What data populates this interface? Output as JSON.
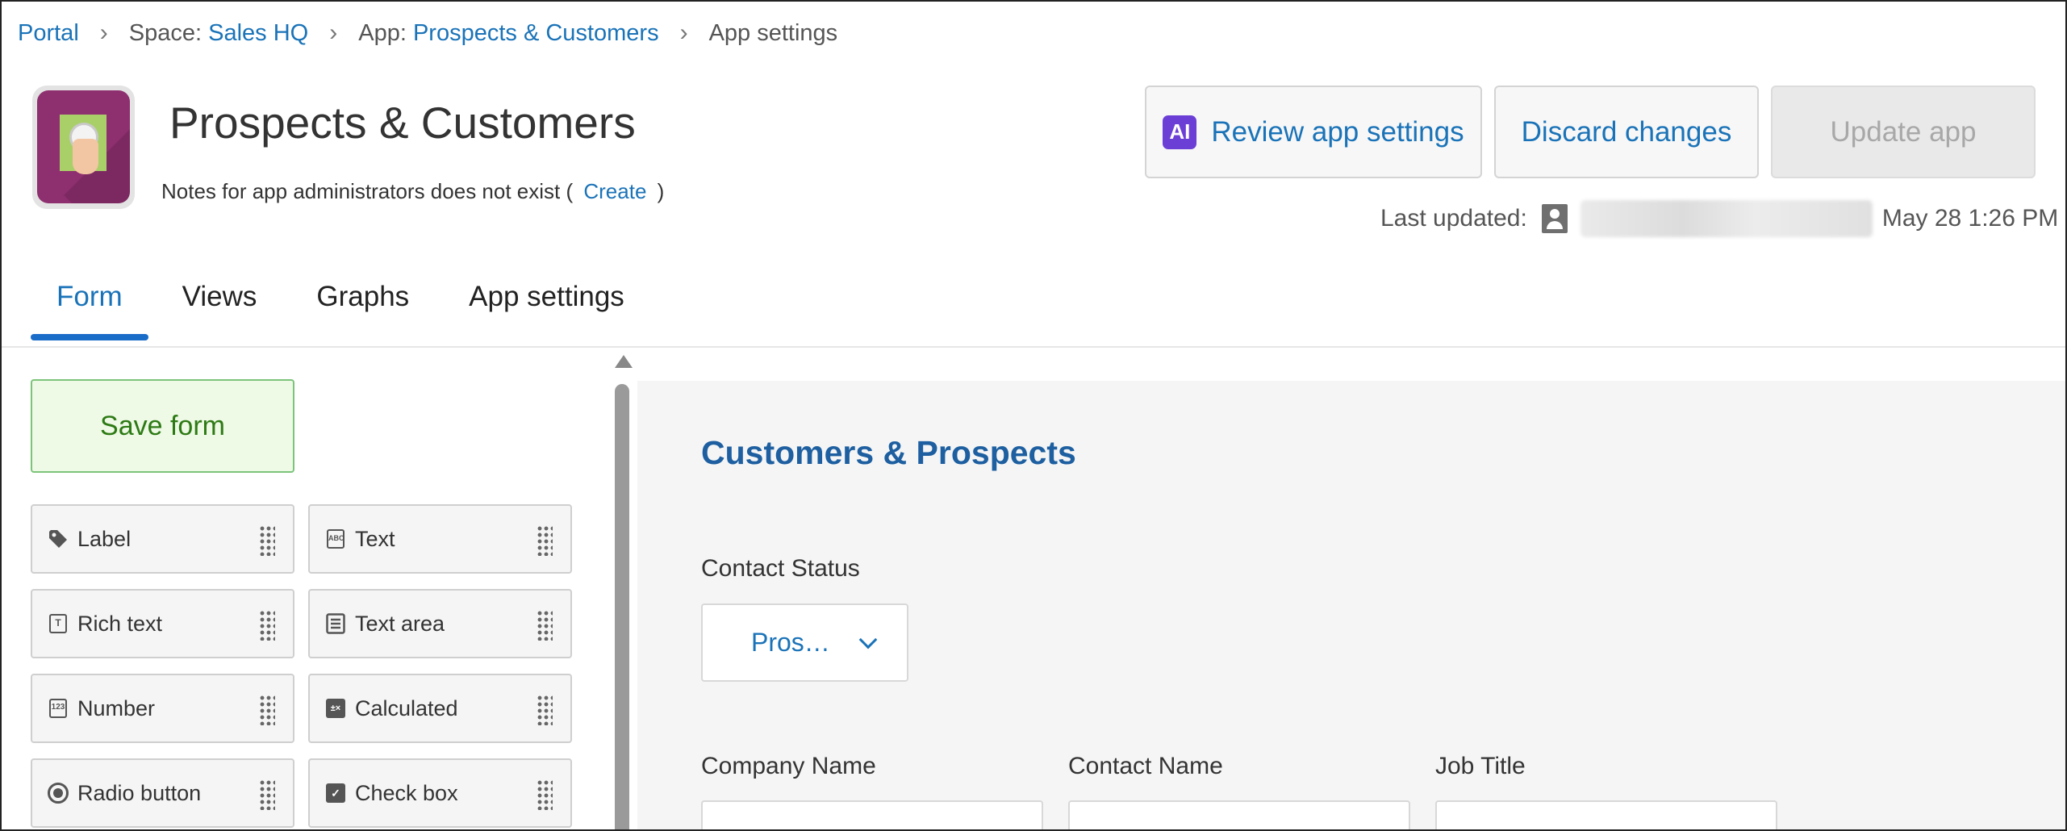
{
  "breadcrumb": {
    "portal": "Portal",
    "space_prefix": "Space:",
    "space_name": "Sales HQ",
    "app_prefix": "App:",
    "app_name": "Prospects & Customers",
    "current": "App settings"
  },
  "app": {
    "title": "Prospects & Customers",
    "notes_text": "Notes for app administrators does not exist (",
    "notes_link": "Create",
    "notes_close": ")"
  },
  "actions": {
    "ai_badge": "AI",
    "review_label": "Review app settings",
    "discard_label": "Discard changes",
    "update_label": "Update app"
  },
  "last_updated": {
    "label": "Last updated:",
    "timestamp": "May 28 1:26 PM"
  },
  "tabs": [
    {
      "label": "Form",
      "active": true
    },
    {
      "label": "Views",
      "active": false
    },
    {
      "label": "Graphs",
      "active": false
    },
    {
      "label": "App settings",
      "active": false
    }
  ],
  "palette": {
    "save_label": "Save form",
    "fields": [
      {
        "label": "Label",
        "icon": "tag-icon"
      },
      {
        "label": "Text",
        "icon": "text-abc-icon"
      },
      {
        "label": "Rich text",
        "icon": "rich-text-icon"
      },
      {
        "label": "Text area",
        "icon": "text-area-icon"
      },
      {
        "label": "Number",
        "icon": "number-123-icon"
      },
      {
        "label": "Calculated",
        "icon": "calculator-icon"
      },
      {
        "label": "Radio button",
        "icon": "radio-icon"
      },
      {
        "label": "Check box",
        "icon": "checkbox-icon"
      }
    ]
  },
  "form": {
    "title": "Customers & Prospects",
    "contact_status_label": "Contact Status",
    "contact_status_value": "Pros…",
    "company_name_label": "Company Name",
    "contact_name_label": "Contact Name",
    "job_title_label": "Job Title"
  },
  "colors": {
    "accent": "#1a73b8",
    "active_tab_underline": "#1a6cc9",
    "save_bg": "#eef9e6",
    "save_border": "#7cc47a",
    "ai_badge": "#6b3fd6",
    "form_title": "#1d5fa0"
  }
}
